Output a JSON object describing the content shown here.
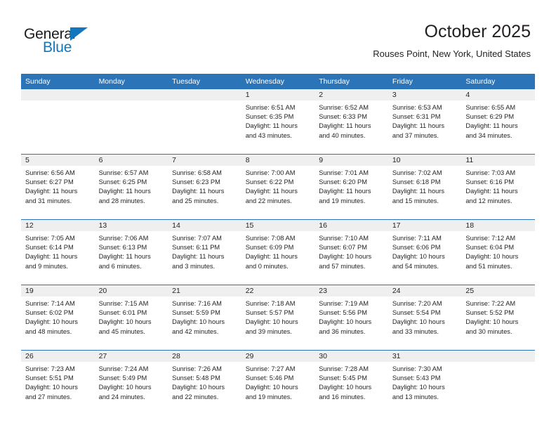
{
  "logo": {
    "word_top": "General",
    "word_bottom": "Blue",
    "triangle_color": "#1277bc",
    "text_color": "#1a1a1a"
  },
  "header": {
    "title": "October 2025",
    "subtitle": "Rouses Point, New York, United States"
  },
  "colors": {
    "header_blue": "#2b74b8",
    "daynum_band": "#efefef",
    "text": "#231f20"
  },
  "weekday_headers": [
    "Sunday",
    "Monday",
    "Tuesday",
    "Wednesday",
    "Thursday",
    "Friday",
    "Saturday"
  ],
  "weeks": [
    [
      {
        "day": "",
        "empty": true
      },
      {
        "day": "",
        "empty": true
      },
      {
        "day": "",
        "empty": true
      },
      {
        "day": "1",
        "sunrise": "Sunrise: 6:51 AM",
        "sunset": "Sunset: 6:35 PM",
        "daylight1": "Daylight: 11 hours",
        "daylight2": "and 43 minutes."
      },
      {
        "day": "2",
        "sunrise": "Sunrise: 6:52 AM",
        "sunset": "Sunset: 6:33 PM",
        "daylight1": "Daylight: 11 hours",
        "daylight2": "and 40 minutes."
      },
      {
        "day": "3",
        "sunrise": "Sunrise: 6:53 AM",
        "sunset": "Sunset: 6:31 PM",
        "daylight1": "Daylight: 11 hours",
        "daylight2": "and 37 minutes."
      },
      {
        "day": "4",
        "sunrise": "Sunrise: 6:55 AM",
        "sunset": "Sunset: 6:29 PM",
        "daylight1": "Daylight: 11 hours",
        "daylight2": "and 34 minutes."
      }
    ],
    [
      {
        "day": "5",
        "sunrise": "Sunrise: 6:56 AM",
        "sunset": "Sunset: 6:27 PM",
        "daylight1": "Daylight: 11 hours",
        "daylight2": "and 31 minutes."
      },
      {
        "day": "6",
        "sunrise": "Sunrise: 6:57 AM",
        "sunset": "Sunset: 6:25 PM",
        "daylight1": "Daylight: 11 hours",
        "daylight2": "and 28 minutes."
      },
      {
        "day": "7",
        "sunrise": "Sunrise: 6:58 AM",
        "sunset": "Sunset: 6:23 PM",
        "daylight1": "Daylight: 11 hours",
        "daylight2": "and 25 minutes."
      },
      {
        "day": "8",
        "sunrise": "Sunrise: 7:00 AM",
        "sunset": "Sunset: 6:22 PM",
        "daylight1": "Daylight: 11 hours",
        "daylight2": "and 22 minutes."
      },
      {
        "day": "9",
        "sunrise": "Sunrise: 7:01 AM",
        "sunset": "Sunset: 6:20 PM",
        "daylight1": "Daylight: 11 hours",
        "daylight2": "and 19 minutes."
      },
      {
        "day": "10",
        "sunrise": "Sunrise: 7:02 AM",
        "sunset": "Sunset: 6:18 PM",
        "daylight1": "Daylight: 11 hours",
        "daylight2": "and 15 minutes."
      },
      {
        "day": "11",
        "sunrise": "Sunrise: 7:03 AM",
        "sunset": "Sunset: 6:16 PM",
        "daylight1": "Daylight: 11 hours",
        "daylight2": "and 12 minutes."
      }
    ],
    [
      {
        "day": "12",
        "sunrise": "Sunrise: 7:05 AM",
        "sunset": "Sunset: 6:14 PM",
        "daylight1": "Daylight: 11 hours",
        "daylight2": "and 9 minutes."
      },
      {
        "day": "13",
        "sunrise": "Sunrise: 7:06 AM",
        "sunset": "Sunset: 6:13 PM",
        "daylight1": "Daylight: 11 hours",
        "daylight2": "and 6 minutes."
      },
      {
        "day": "14",
        "sunrise": "Sunrise: 7:07 AM",
        "sunset": "Sunset: 6:11 PM",
        "daylight1": "Daylight: 11 hours",
        "daylight2": "and 3 minutes."
      },
      {
        "day": "15",
        "sunrise": "Sunrise: 7:08 AM",
        "sunset": "Sunset: 6:09 PM",
        "daylight1": "Daylight: 11 hours",
        "daylight2": "and 0 minutes."
      },
      {
        "day": "16",
        "sunrise": "Sunrise: 7:10 AM",
        "sunset": "Sunset: 6:07 PM",
        "daylight1": "Daylight: 10 hours",
        "daylight2": "and 57 minutes."
      },
      {
        "day": "17",
        "sunrise": "Sunrise: 7:11 AM",
        "sunset": "Sunset: 6:06 PM",
        "daylight1": "Daylight: 10 hours",
        "daylight2": "and 54 minutes."
      },
      {
        "day": "18",
        "sunrise": "Sunrise: 7:12 AM",
        "sunset": "Sunset: 6:04 PM",
        "daylight1": "Daylight: 10 hours",
        "daylight2": "and 51 minutes."
      }
    ],
    [
      {
        "day": "19",
        "sunrise": "Sunrise: 7:14 AM",
        "sunset": "Sunset: 6:02 PM",
        "daylight1": "Daylight: 10 hours",
        "daylight2": "and 48 minutes."
      },
      {
        "day": "20",
        "sunrise": "Sunrise: 7:15 AM",
        "sunset": "Sunset: 6:01 PM",
        "daylight1": "Daylight: 10 hours",
        "daylight2": "and 45 minutes."
      },
      {
        "day": "21",
        "sunrise": "Sunrise: 7:16 AM",
        "sunset": "Sunset: 5:59 PM",
        "daylight1": "Daylight: 10 hours",
        "daylight2": "and 42 minutes."
      },
      {
        "day": "22",
        "sunrise": "Sunrise: 7:18 AM",
        "sunset": "Sunset: 5:57 PM",
        "daylight1": "Daylight: 10 hours",
        "daylight2": "and 39 minutes."
      },
      {
        "day": "23",
        "sunrise": "Sunrise: 7:19 AM",
        "sunset": "Sunset: 5:56 PM",
        "daylight1": "Daylight: 10 hours",
        "daylight2": "and 36 minutes."
      },
      {
        "day": "24",
        "sunrise": "Sunrise: 7:20 AM",
        "sunset": "Sunset: 5:54 PM",
        "daylight1": "Daylight: 10 hours",
        "daylight2": "and 33 minutes."
      },
      {
        "day": "25",
        "sunrise": "Sunrise: 7:22 AM",
        "sunset": "Sunset: 5:52 PM",
        "daylight1": "Daylight: 10 hours",
        "daylight2": "and 30 minutes."
      }
    ],
    [
      {
        "day": "26",
        "sunrise": "Sunrise: 7:23 AM",
        "sunset": "Sunset: 5:51 PM",
        "daylight1": "Daylight: 10 hours",
        "daylight2": "and 27 minutes."
      },
      {
        "day": "27",
        "sunrise": "Sunrise: 7:24 AM",
        "sunset": "Sunset: 5:49 PM",
        "daylight1": "Daylight: 10 hours",
        "daylight2": "and 24 minutes."
      },
      {
        "day": "28",
        "sunrise": "Sunrise: 7:26 AM",
        "sunset": "Sunset: 5:48 PM",
        "daylight1": "Daylight: 10 hours",
        "daylight2": "and 22 minutes."
      },
      {
        "day": "29",
        "sunrise": "Sunrise: 7:27 AM",
        "sunset": "Sunset: 5:46 PM",
        "daylight1": "Daylight: 10 hours",
        "daylight2": "and 19 minutes."
      },
      {
        "day": "30",
        "sunrise": "Sunrise: 7:28 AM",
        "sunset": "Sunset: 5:45 PM",
        "daylight1": "Daylight: 10 hours",
        "daylight2": "and 16 minutes."
      },
      {
        "day": "31",
        "sunrise": "Sunrise: 7:30 AM",
        "sunset": "Sunset: 5:43 PM",
        "daylight1": "Daylight: 10 hours",
        "daylight2": "and 13 minutes."
      },
      {
        "day": "",
        "empty": true
      }
    ]
  ]
}
